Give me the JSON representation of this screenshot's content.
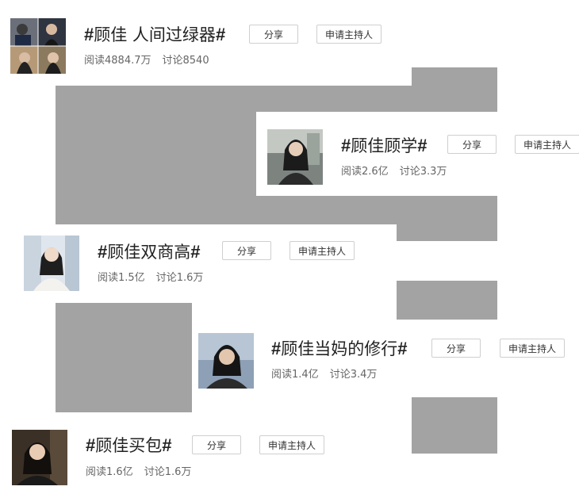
{
  "buttons": {
    "share": "分享",
    "apply_host": "申请主持人"
  },
  "topics": [
    {
      "hash_open": "#",
      "name": "顾佳 人间过绿器",
      "hash_close": "#",
      "read": "阅读4884.7万",
      "discuss": "讨论8540"
    },
    {
      "hash_open": "#",
      "name": "顾佳顾学",
      "hash_close": "#",
      "read": "阅读2.6亿",
      "discuss": "讨论3.3万"
    },
    {
      "hash_open": "#",
      "name": "顾佳双商高",
      "hash_close": "#",
      "read": "阅读1.5亿",
      "discuss": "讨论1.6万"
    },
    {
      "hash_open": "#",
      "name": "顾佳当妈的修行",
      "hash_close": "#",
      "read": "阅读1.4亿",
      "discuss": "讨论3.4万"
    },
    {
      "hash_open": "#",
      "name": "顾佳买包",
      "hash_close": "#",
      "read": "阅读1.6亿",
      "discuss": "讨论1.6万"
    }
  ],
  "colors": {
    "gray_band": "#a3a3a3",
    "title_text": "#222222",
    "meta_text": "#666666",
    "button_border": "#cfcfcf"
  }
}
